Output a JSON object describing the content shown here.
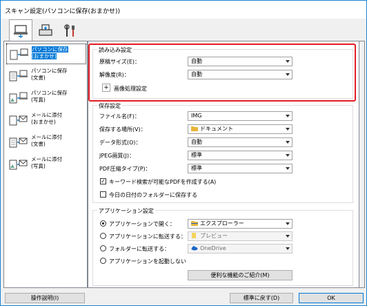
{
  "window": {
    "title": "スキャン設定(パソコンに保存(おまかせ))"
  },
  "toolbar": {
    "icons": [
      "scan-to-pc-icon",
      "scan-from-panel-icon",
      "general-settings-icon"
    ]
  },
  "sidebar": {
    "items": [
      {
        "label": "パソコンに保存\n(おまかせ)",
        "selected": true
      },
      {
        "label": "パソコンに保存\n(文書)"
      },
      {
        "label": "パソコンに保存\n(写真)"
      },
      {
        "label": "メールに添付\n(おまかせ)"
      },
      {
        "label": "メールに添付\n(文書)"
      },
      {
        "label": "メールに添付\n(写真)"
      }
    ]
  },
  "scan_options": {
    "title": "読み込み設定",
    "paper_size_label": "原稿サイズ(E)：",
    "paper_size_value": "自動",
    "resolution_label": "解像度(R)：",
    "resolution_value": "自動",
    "image_processing_label": "画像処理設定",
    "expand_symbol": "+"
  },
  "save_settings": {
    "title": "保存設定",
    "file_name_label": "ファイル名(F)：",
    "file_name_value": "IMG",
    "save_in_label": "保存する場所(V)：",
    "save_in_value": "ドキュメント",
    "data_format_label": "データ形式(O)：",
    "data_format_value": "自動",
    "jpeg_quality_label": "JPEG画質(J)：",
    "jpeg_quality_value": "標準",
    "pdf_compression_label": "PDF圧縮タイプ(P)：",
    "pdf_compression_value": "標準",
    "keyword_pdf_label": "キーワード検索が可能なPDFを作成する(A)",
    "keyword_pdf_checked": true,
    "date_folder_label": "今日の日付のフォルダーに保存する",
    "date_folder_checked": false,
    "check_mark": "✓"
  },
  "app_settings": {
    "title": "アプリケーション設定",
    "open_app_label": "アプリケーションで開く：",
    "open_app_value": "エクスプローラー",
    "send_app_label": "アプリケーションに転送する：",
    "send_app_value": "プレビュー",
    "send_folder_label": "フォルダーに転送する：",
    "send_folder_value": "OneDrive",
    "no_app_label": "アプリケーションを起動しない",
    "more_functions_label": "便利な機能のご紹介(M)"
  },
  "footer": {
    "instructions_label": "操作説明(I)",
    "defaults_label": "標準に戻す(D)",
    "ok_label": "OK"
  },
  "colors": {
    "accent": "#0078d7",
    "highlight": "#e31b23",
    "folder": "#e8b53a",
    "onedrive": "#1a66c6"
  }
}
